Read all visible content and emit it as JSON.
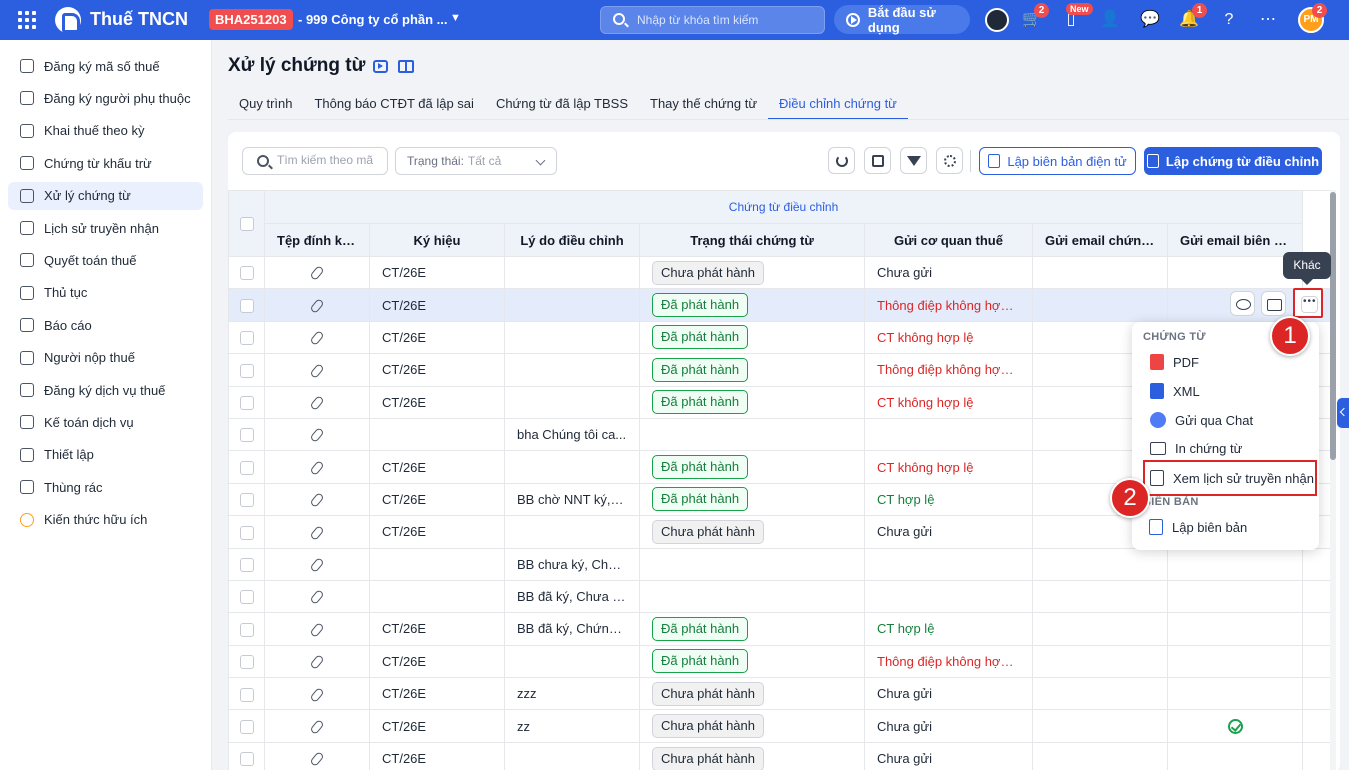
{
  "app": {
    "title": "Thuế TNCN",
    "org_code": "BHA251203",
    "org_name": "- 999 Công ty cổ phần ..."
  },
  "topbar": {
    "search_placeholder": "Nhập từ khóa tìm kiếm",
    "start_label": "Bắt đầu sử dụng",
    "cart_badge": "2",
    "new_badge": "New",
    "notif_badge": "1",
    "avatar_initials": "PM",
    "avatar_badge": "2"
  },
  "sidebar": {
    "items": [
      {
        "label": "Đăng ký mã số thuế",
        "icon": "scan-icon"
      },
      {
        "label": "Đăng ký người phụ thuộc",
        "icon": "users-icon"
      },
      {
        "label": "Khai thuế theo kỳ",
        "icon": "document-icon"
      },
      {
        "label": "Chứng từ khấu trừ",
        "icon": "folder-icon"
      },
      {
        "label": "Xử lý chứng từ",
        "icon": "edit-document-icon",
        "active": true
      },
      {
        "label": "Lịch sử truyền nhận",
        "icon": "transfer-icon"
      },
      {
        "label": "Quyết toán thuế",
        "icon": "folder-icon"
      },
      {
        "label": "Thủ tục",
        "icon": "folder-icon"
      },
      {
        "label": "Báo cáo",
        "icon": "pie-chart-icon"
      },
      {
        "label": "Người nộp thuế",
        "icon": "id-card-icon"
      },
      {
        "label": "Đăng ký dịch vụ thuế",
        "icon": "service-icon"
      },
      {
        "label": "Kế toán dịch vụ",
        "icon": "accounting-icon"
      },
      {
        "label": "Thiết lập",
        "icon": "gear-icon"
      },
      {
        "label": "Thùng rác",
        "icon": "trash-icon"
      },
      {
        "label": "Kiến thức hữu ích",
        "icon": "lightbulb-icon"
      }
    ]
  },
  "page": {
    "title": "Xử lý chứng từ"
  },
  "tabs": [
    "Quy trình",
    "Thông báo CTĐT đã lập sai",
    "Chứng từ đã lập TBSS",
    "Thay thế chứng từ",
    "Điều chỉnh chứng từ"
  ],
  "active_tab": "Điều chỉnh chứng từ",
  "toolbar": {
    "search_placeholder": "Tìm kiếm theo mã",
    "status_label": "Trạng thái:",
    "status_value": "Tất cả",
    "report_btn": "Lập biên bản điện tử",
    "adjust_btn": "Lập chứng từ điều chỉnh"
  },
  "table": {
    "group_header": "Chứng từ điều chỉnh",
    "columns": [
      "Tệp đính kèm",
      "Ký hiệu",
      "Lý do điều chỉnh",
      "Trạng thái chứng từ",
      "Gửi cơ quan thuế",
      "Gửi email chứng từ",
      "Gửi email biên bản"
    ],
    "rows": [
      {
        "kh": "CT/26E",
        "reason": "",
        "status": "Chưa phát hành",
        "cqt": "Chưa gửi",
        "cqt_color": "normal",
        "email_bb": ""
      },
      {
        "kh": "CT/26E",
        "reason": "",
        "status": "Đã phát hành",
        "cqt": "Thông điệp không hợp lệ",
        "cqt_color": "red",
        "email_bb": "",
        "selected": true
      },
      {
        "kh": "CT/26E",
        "reason": "",
        "status": "Đã phát hành",
        "cqt": "CT không hợp lệ",
        "cqt_color": "red",
        "email_bb": ""
      },
      {
        "kh": "CT/26E",
        "reason": "",
        "status": "Đã phát hành",
        "cqt": "Thông điệp không hợp lệ",
        "cqt_color": "red",
        "email_bb": ""
      },
      {
        "kh": "CT/26E",
        "reason": "",
        "status": "Đã phát hành",
        "cqt": "CT không hợp lệ",
        "cqt_color": "red",
        "email_bb": ""
      },
      {
        "kh": "",
        "reason": "bha Chúng tôi ca...",
        "status": "",
        "cqt": "",
        "cqt_color": "normal",
        "email_bb": ""
      },
      {
        "kh": "CT/26E",
        "reason": "",
        "status": "Đã phát hành",
        "cqt": "CT không hợp lệ",
        "cqt_color": "red",
        "email_bb": ""
      },
      {
        "kh": "CT/26E",
        "reason": "BB chờ NNT ký, C...",
        "status": "Đã phát hành",
        "cqt": "CT hợp lệ",
        "cqt_color": "green",
        "email_bb": ""
      },
      {
        "kh": "CT/26E",
        "reason": "",
        "status": "Chưa phát hành",
        "cqt": "Chưa gửi",
        "cqt_color": "normal",
        "email_bb": ""
      },
      {
        "kh": "",
        "reason": "BB chưa ký, Chứn...",
        "status": "",
        "cqt": "",
        "cqt_color": "normal",
        "email_bb": ""
      },
      {
        "kh": "",
        "reason": "BB đã ký, Chưa lậ...",
        "status": "",
        "cqt": "",
        "cqt_color": "normal",
        "email_bb": ""
      },
      {
        "kh": "CT/26E",
        "reason": "BB đã ký, Chứng t...",
        "status": "Đã phát hành",
        "cqt": "CT hợp lệ",
        "cqt_color": "green",
        "email_bb": ""
      },
      {
        "kh": "CT/26E",
        "reason": "",
        "status": "Đã phát hành",
        "cqt": "Thông điệp không hợp lệ",
        "cqt_color": "red",
        "email_bb": ""
      },
      {
        "kh": "CT/26E",
        "reason": "zzz",
        "status": "Chưa phát hành",
        "cqt": "Chưa gửi",
        "cqt_color": "normal",
        "email_bb": ""
      },
      {
        "kh": "CT/26E",
        "reason": "zz",
        "status": "Chưa phát hành",
        "cqt": "Chưa gửi",
        "cqt_color": "normal",
        "email_bb": "check"
      },
      {
        "kh": "CT/26E",
        "reason": "",
        "status": "Chưa phát hành",
        "cqt": "Chưa gửi",
        "cqt_color": "normal",
        "email_bb": ""
      }
    ]
  },
  "tooltip": "Khác",
  "menu": {
    "section1": "CHỨNG TỪ",
    "items1": [
      "PDF",
      "XML",
      "Gửi qua Chat",
      "In chứng từ",
      "Xem lịch sử truyền nhận"
    ],
    "section2": "BIÊN BẢN",
    "items2": [
      "Lập biên bản"
    ]
  },
  "markers": [
    "1",
    "2"
  ],
  "colors": {
    "primary": "#2b5fe0",
    "danger": "#dc2626",
    "success": "#15803d",
    "highlight": "#dc2626"
  }
}
